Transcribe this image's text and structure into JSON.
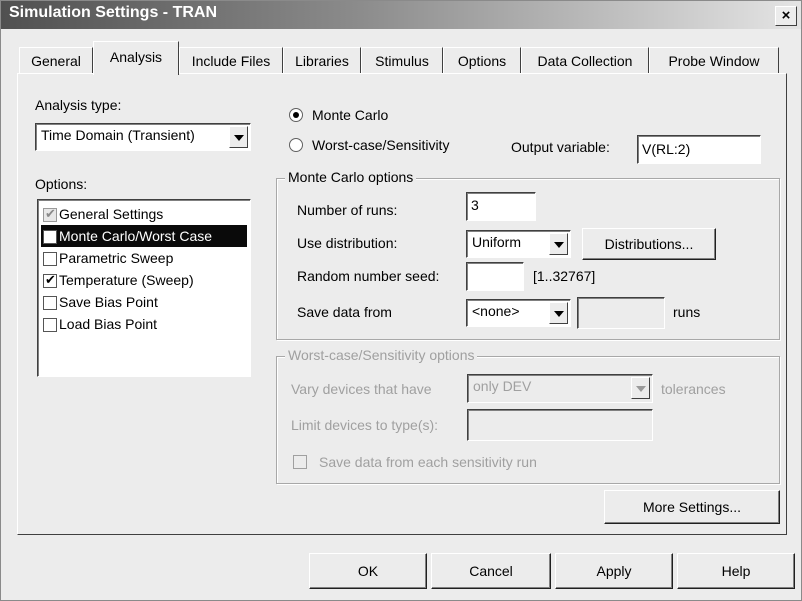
{
  "window": {
    "title": "Simulation Settings - TRAN",
    "close_glyph": "×"
  },
  "tabs": [
    {
      "label": "General",
      "active": false
    },
    {
      "label": "Analysis",
      "active": true
    },
    {
      "label": "Include Files",
      "active": false
    },
    {
      "label": "Libraries",
      "active": false
    },
    {
      "label": "Stimulus",
      "active": false
    },
    {
      "label": "Options",
      "active": false
    },
    {
      "label": "Data Collection",
      "active": false
    },
    {
      "label": "Probe Window",
      "active": false
    }
  ],
  "analysis": {
    "type_label": "Analysis type:",
    "type_value": "Time Domain (Transient)",
    "options_label": "Options:",
    "options": [
      {
        "label": "General Settings",
        "checked": true,
        "disabled": true,
        "selected": false
      },
      {
        "label": "Monte Carlo/Worst Case",
        "checked": true,
        "disabled": false,
        "selected": true
      },
      {
        "label": "Parametric Sweep",
        "checked": false,
        "disabled": false,
        "selected": false
      },
      {
        "label": "Temperature (Sweep)",
        "checked": true,
        "disabled": false,
        "selected": false
      },
      {
        "label": "Save Bias Point",
        "checked": false,
        "disabled": false,
        "selected": false
      },
      {
        "label": "Load Bias Point",
        "checked": false,
        "disabled": false,
        "selected": false
      }
    ]
  },
  "mode": {
    "monte_carlo_label": "Monte Carlo",
    "worst_case_label": "Worst-case/Sensitivity",
    "selected": "monte_carlo",
    "output_variable_label": "Output variable:",
    "output_variable_value": "V(RL:2)"
  },
  "monte_carlo": {
    "group_label": "Monte Carlo options",
    "num_runs_label": "Number of runs:",
    "num_runs_value": "3",
    "distribution_label": "Use distribution:",
    "distribution_value": "Uniform",
    "distributions_button": "Distributions...",
    "seed_label": "Random number seed:",
    "seed_value": "",
    "seed_range": "[1..32767]",
    "save_data_label": "Save data from",
    "save_data_value": "<none>",
    "save_data_runs_value": "",
    "runs_label": "runs"
  },
  "worst_case": {
    "group_label": "Worst-case/Sensitivity options",
    "vary_label": "Vary devices that have",
    "vary_value": "only DEV",
    "tolerances_label": "tolerances",
    "limit_label": "Limit devices to type(s):",
    "limit_value": "",
    "save_each_label": "Save data from each sensitivity run"
  },
  "more_settings_button": "More Settings...",
  "footer": {
    "ok": "OK",
    "cancel": "Cancel",
    "apply": "Apply",
    "help": "Help"
  },
  "check_glyph": "✔"
}
